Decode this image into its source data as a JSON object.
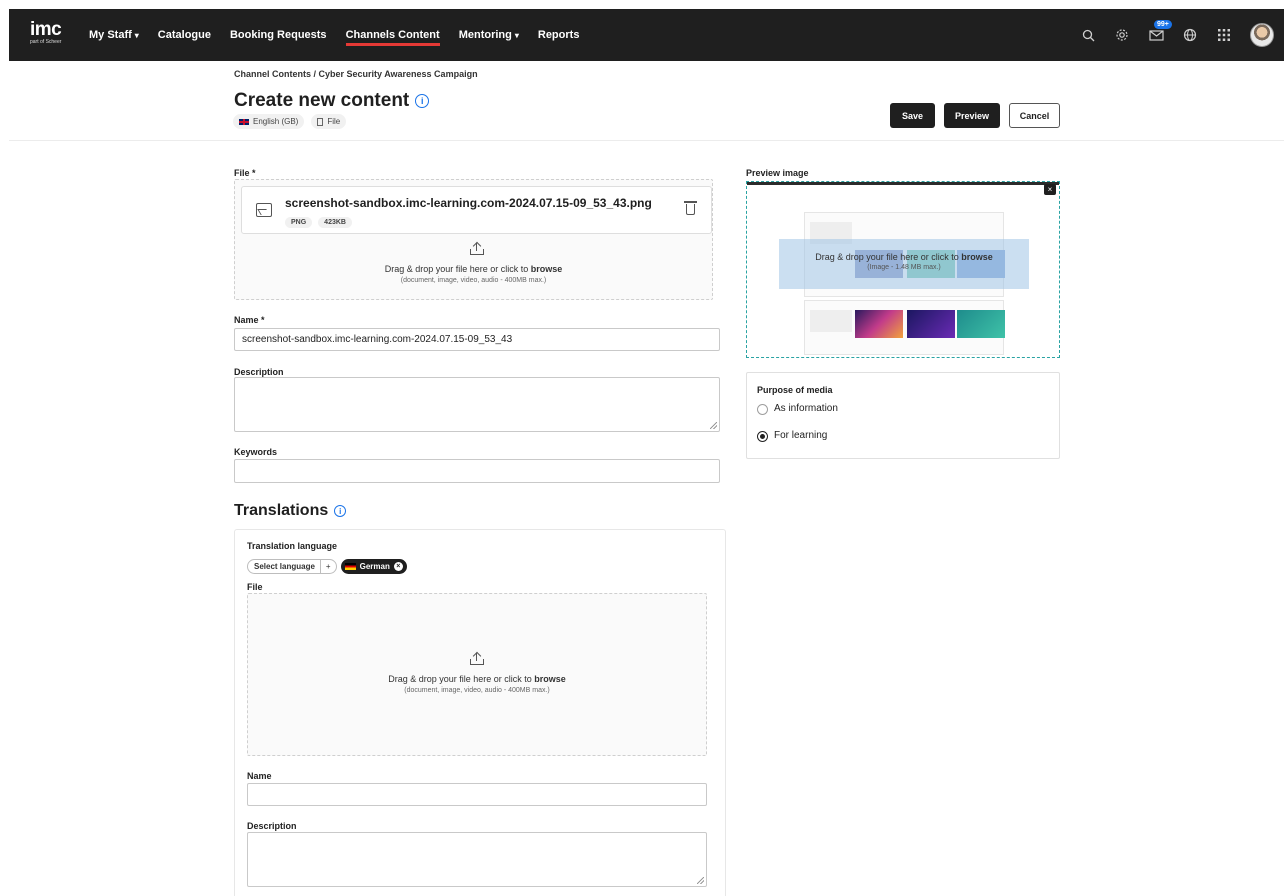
{
  "nav": {
    "logo": "imc",
    "logo_sub": "part of Scheer",
    "items": [
      {
        "label": "My Staff",
        "has_caret": true
      },
      {
        "label": "Catalogue",
        "has_caret": false
      },
      {
        "label": "Booking Requests",
        "has_caret": false
      },
      {
        "label": "Channels Content",
        "has_caret": false,
        "active": true
      },
      {
        "label": "Mentoring",
        "has_caret": true
      },
      {
        "label": "Reports",
        "has_caret": false
      }
    ],
    "caret": "▾",
    "notification_badge": "99+",
    "accent_color": "#e53935"
  },
  "header": {
    "breadcrumb": "Channel Contents / Cyber Security Awareness Campaign",
    "title": "Create new content",
    "info_glyph": "i",
    "chip_language": "English (GB)",
    "chip_type": "File",
    "save_label": "Save",
    "preview_label": "Preview",
    "cancel_label": "Cancel"
  },
  "file_section": {
    "label": "File *",
    "file_name": "screenshot-sandbox.imc-learning.com-2024.07.15-09_53_43.png",
    "file_format": "PNG",
    "file_size": "423KB",
    "drop_text_prefix": "Drag & drop your file here or click to ",
    "drop_text_link": "browse",
    "drop_hint": "(document, image, video, audio - 400MB max.)"
  },
  "name_field": {
    "label": "Name *",
    "value": "screenshot-sandbox.imc-learning.com-2024.07.15-09_53_43"
  },
  "description_field": {
    "label": "Description",
    "value": ""
  },
  "keywords_field": {
    "label": "Keywords",
    "value": ""
  },
  "preview_image": {
    "label": "Preview image",
    "drop_text_prefix": "Drag & drop your file here or click to ",
    "drop_text_link": "browse",
    "drop_hint": "(Image - 1.48 MB max.)",
    "close_glyph": "×"
  },
  "purpose": {
    "label": "Purpose of media",
    "options": [
      {
        "label": "As information",
        "selected": false
      },
      {
        "label": "For learning",
        "selected": true
      }
    ]
  },
  "translations": {
    "title": "Translations",
    "language_label": "Translation language",
    "select_language": "Select language",
    "add_glyph": "+",
    "selected_language": "German",
    "remove_glyph": "×",
    "file_label": "File",
    "drop_text_prefix": "Drag & drop your file here or click to ",
    "drop_text_link": "browse",
    "drop_hint": "(document, image, video, audio - 400MB max.)",
    "name_label": "Name",
    "name_value": "",
    "description_label": "Description",
    "description_value": ""
  }
}
